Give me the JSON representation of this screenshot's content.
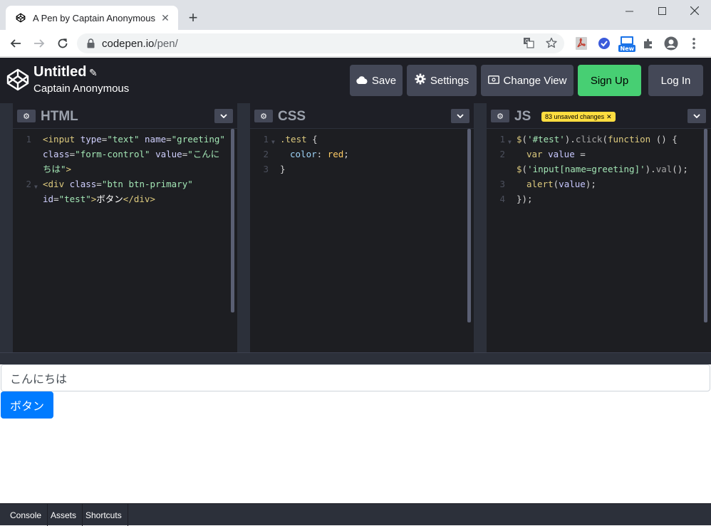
{
  "browser": {
    "tab_title": "A Pen by Captain Anonymous",
    "url_host": "codepen.io",
    "url_path": "/pen/",
    "ext_new_badge": "New"
  },
  "header": {
    "title": "Untitled",
    "author": "Captain Anonymous",
    "save_label": "Save",
    "settings_label": "Settings",
    "change_view_label": "Change View",
    "signup_label": "Sign Up",
    "login_label": "Log In"
  },
  "editors": {
    "html": {
      "title": "HTML",
      "line_numbers": [
        "1",
        "2"
      ]
    },
    "css": {
      "title": "CSS",
      "line_numbers": [
        "1",
        "2",
        "3"
      ]
    },
    "js": {
      "title": "JS",
      "line_numbers": [
        "1",
        "2",
        "3",
        "4"
      ],
      "unsaved_badge": "83 unsaved changes"
    }
  },
  "preview": {
    "input_value": "こんにちは",
    "button_label": "ボタン"
  },
  "footer": {
    "tabs": [
      "Console",
      "Assets",
      "Shortcuts"
    ]
  },
  "colors": {
    "accent_green": "#47cf73",
    "editor_bg": "#1d1e22",
    "header_bg": "#1e1f26",
    "primary_blue": "#007bff",
    "badge_yellow": "#ffdd40"
  }
}
